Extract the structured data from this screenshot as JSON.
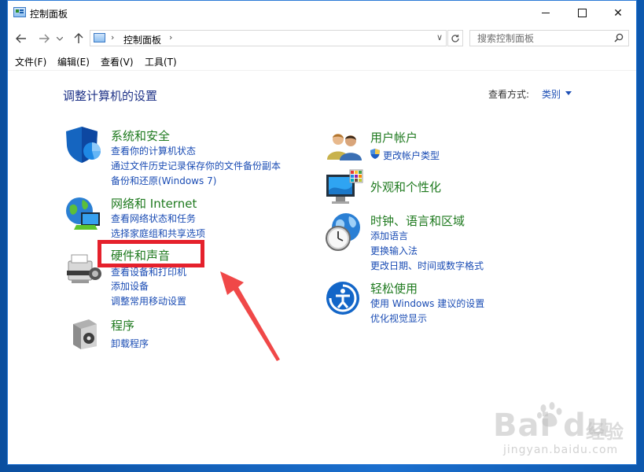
{
  "window": {
    "title": "控制面板",
    "controls": {
      "minimize": "minimize",
      "maximize": "maximize",
      "close": "✕"
    }
  },
  "address": {
    "path": "控制面板",
    "search_placeholder": "搜索控制面板"
  },
  "menu": [
    "文件(F)",
    "编辑(E)",
    "查看(V)",
    "工具(T)"
  ],
  "content": {
    "title": "调整计算机的设置",
    "view_by_label": "查看方式:",
    "view_by_value": "类别"
  },
  "categories": {
    "system_security": {
      "title": "系统和安全",
      "links": [
        "查看你的计算机状态",
        "通过文件历史记录保存你的文件备份副本",
        "备份和还原(Windows 7)"
      ]
    },
    "network": {
      "title": "网络和 Internet",
      "links": [
        "查看网络状态和任务",
        "选择家庭组和共享选项"
      ]
    },
    "hardware_sound": {
      "title": "硬件和声音",
      "links": [
        "查看设备和打印机",
        "添加设备",
        "调整常用移动设置"
      ]
    },
    "programs": {
      "title": "程序",
      "links": [
        "卸载程序"
      ]
    },
    "user_accounts": {
      "title": "用户帐户",
      "links": [
        "更改帐户类型"
      ]
    },
    "appearance": {
      "title": "外观和个性化",
      "links": []
    },
    "clock_region": {
      "title": "时钟、语言和区域",
      "links": [
        "添加语言",
        "更换输入法",
        "更改日期、时间或数字格式"
      ]
    },
    "ease_access": {
      "title": "轻松使用",
      "links": [
        "使用 Windows 建议的设置",
        "优化视觉显示"
      ]
    }
  },
  "annotation": {
    "highlight_text": "硬件和声音"
  },
  "watermark": {
    "brand": "Bai du",
    "cn": "经验",
    "url": "jingyan.baidu.com"
  },
  "icons": {
    "app": "control-panel-icon",
    "search": "search-icon",
    "shield": "uac-shield-icon"
  },
  "colors": {
    "link": "#1a4cb4",
    "category": "#1f7a1f",
    "title": "#1e3287",
    "highlight": "#e5212c"
  }
}
